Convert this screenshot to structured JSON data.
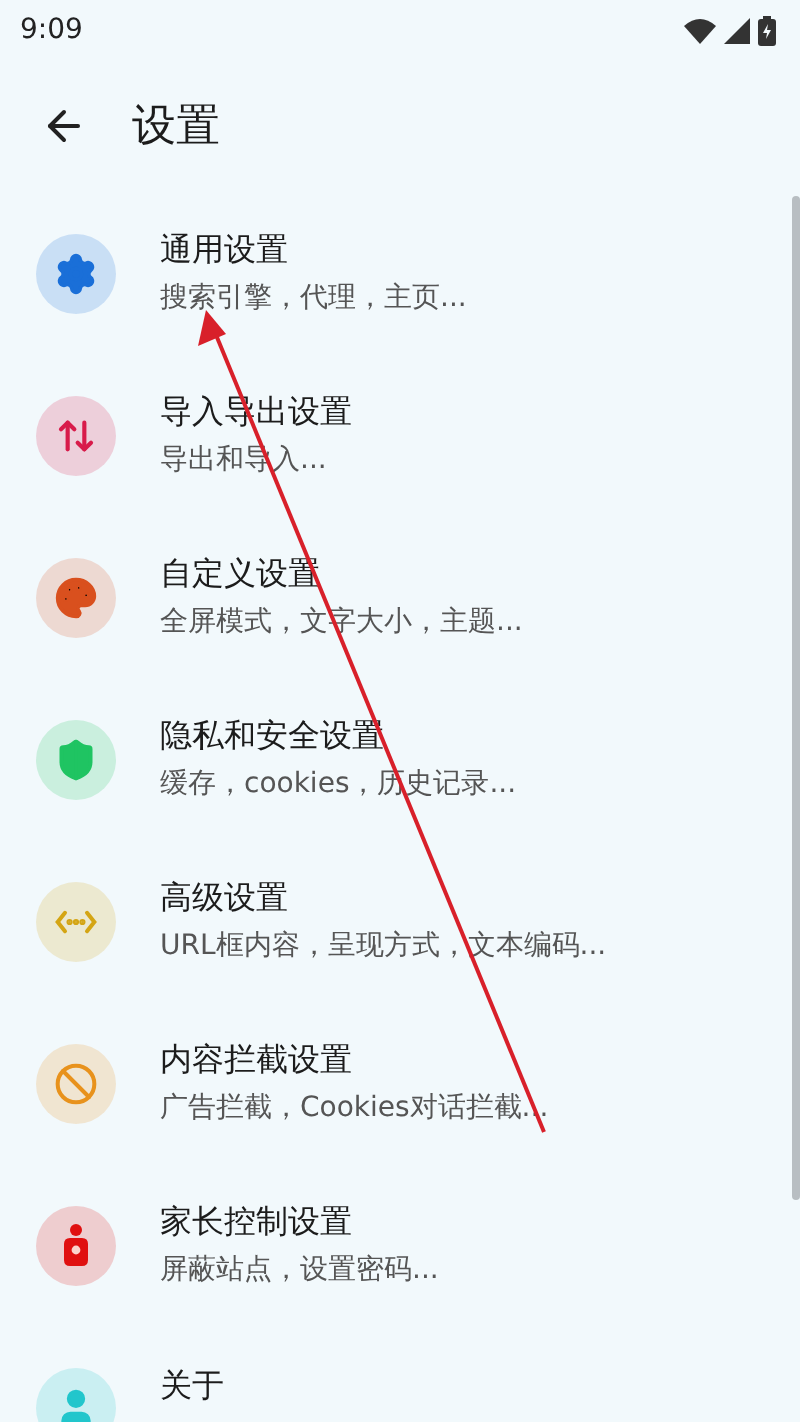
{
  "status_bar": {
    "time": "9:09"
  },
  "toolbar": {
    "title": "设置"
  },
  "items": [
    {
      "title": "通用设置",
      "subtitle": "搜索引擎，代理，主页...",
      "color": "#1a6fd8"
    },
    {
      "title": "导入导出设置",
      "subtitle": "导出和导入...",
      "color": "#d81b4a"
    },
    {
      "title": "自定义设置",
      "subtitle": "全屏模式，文字大小，主题...",
      "color": "#d9501e"
    },
    {
      "title": "隐私和安全设置",
      "subtitle": "缓存，cookies，历史记录...",
      "color": "#1fc462"
    },
    {
      "title": "高级设置",
      "subtitle": "URL框内容，呈现方式，文本编码...",
      "color": "#d4a514"
    },
    {
      "title": "内容拦截设置",
      "subtitle": "广告拦截，Cookies对话拦截...",
      "color": "#e8921c"
    },
    {
      "title": "家长控制设置",
      "subtitle": "屏蔽站点，设置密码...",
      "color": "#e01010"
    },
    {
      "title": "关于",
      "color": "#22c6cc"
    }
  ]
}
